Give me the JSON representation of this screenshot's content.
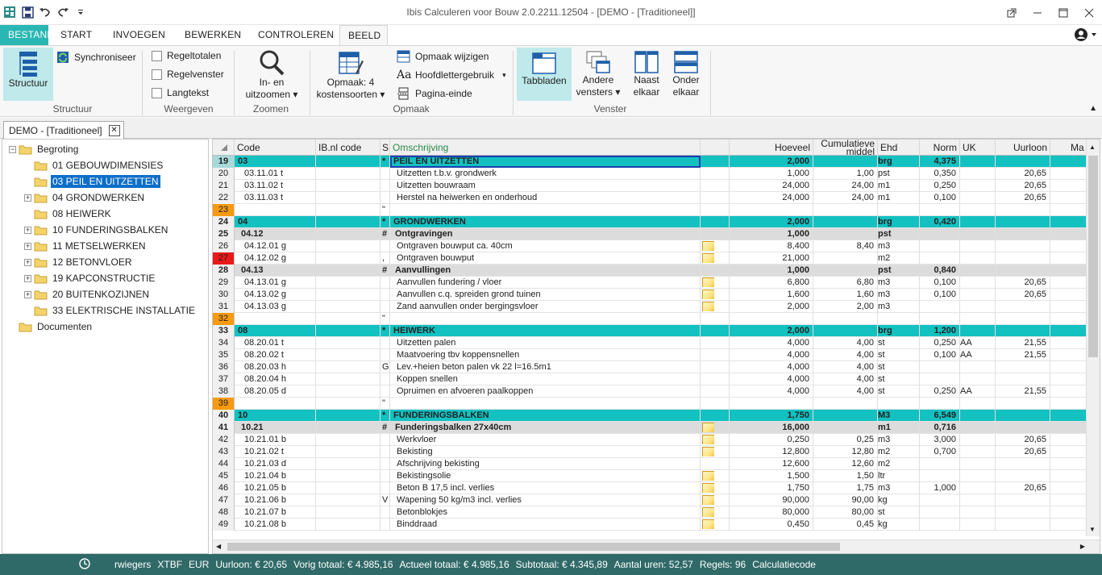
{
  "window": {
    "title": "Ibis Calculeren voor Bouw 2.0.2211.12504 - [DEMO - [Traditioneel]]"
  },
  "ribbon_tabs": [
    "BESTAND",
    "START",
    "INVOEGEN",
    "BEWERKEN",
    "CONTROLEREN",
    "BEELD"
  ],
  "ribbon": {
    "structuur": {
      "btn": "Structuur",
      "sync": "Synchroniseer",
      "group": "Structuur"
    },
    "weergeven": {
      "items": [
        "Regeltotalen",
        "Regelvenster",
        "Langtekst"
      ],
      "group": "Weergeven"
    },
    "zoomen": {
      "line1": "In- en",
      "line2": "uitzoomen",
      "group": "Zoomen"
    },
    "opmaak": {
      "btn_line1": "Opmaak: 4",
      "btn_line2": "kostensoorten",
      "wijzigen": "Opmaak wijzigen",
      "hoofdletter": "Hoofdlettergebruik",
      "pagina": "Pagina-einde",
      "group": "Opmaak"
    },
    "venster": {
      "tabbladen": "Tabbladen",
      "andere1": "Andere",
      "andere2": "vensters",
      "naast1": "Naast",
      "naast2": "elkaar",
      "onder1": "Onder",
      "onder2": "elkaar",
      "group": "Venster"
    }
  },
  "doc_tab": "DEMO - [Traditioneel]",
  "tree": {
    "root": "Begroting",
    "items": [
      {
        "label": "01 GEBOUWDIMENSIES",
        "expandable": false
      },
      {
        "label": "03 PEIL EN UITZETTEN",
        "expandable": false
      },
      {
        "label": "04 GRONDWERKEN",
        "expandable": true
      },
      {
        "label": "08 HEIWERK",
        "expandable": false
      },
      {
        "label": "10 FUNDERINGSBALKEN",
        "expandable": true
      },
      {
        "label": "11 METSELWERKEN",
        "expandable": true
      },
      {
        "label": "12 BETONVLOER",
        "expandable": true
      },
      {
        "label": "19 KAPCONSTRUCTIE",
        "expandable": true
      },
      {
        "label": "20 BUITENKOZIJNEN",
        "expandable": true
      },
      {
        "label": "33 ELEKTRISCHE INSTALLATIE",
        "expandable": false
      }
    ],
    "documents": "Documenten"
  },
  "grid": {
    "headers": {
      "code": "Code",
      "ibnl": "IB.nl code",
      "s": "S",
      "omschrijving": "Omschrijving",
      "hoeveel": "Hoeveel",
      "cum1": "Cumulatieve",
      "cum2": "middel",
      "ehd": "Ehd",
      "norm": "Norm",
      "uk": "UK",
      "uurloon": "Uurloon",
      "ma": "Ma"
    },
    "rows": [
      {
        "n": "19",
        "style": "teal",
        "rn": "active",
        "code": "03",
        "s": "*",
        "desc": "PEIL EN UITZETTEN",
        "qty": "2,000",
        "cum": "",
        "ehd": "brg",
        "norm": "4,375",
        "uk": "",
        "uur": "",
        "note": false
      },
      {
        "n": "20",
        "style": "",
        "rn": "",
        "code": "03.11.01  t",
        "s": "",
        "desc": "Uitzetten t.b.v. grondwerk",
        "qty": "1,000",
        "cum": "1,00",
        "ehd": "pst",
        "norm": "0,350",
        "uk": "",
        "uur": "20,65",
        "note": false
      },
      {
        "n": "21",
        "style": "",
        "rn": "",
        "code": "03.11.02  t",
        "s": "",
        "desc": "Uitzetten bouwraam",
        "qty": "24,000",
        "cum": "24,00",
        "ehd": "m1",
        "norm": "0,250",
        "uk": "",
        "uur": "20,65",
        "note": false
      },
      {
        "n": "22",
        "style": "",
        "rn": "",
        "code": "03.11.03  t",
        "s": "",
        "desc": "Herstel na heiwerken en onderhoud",
        "qty": "24,000",
        "cum": "24,00",
        "ehd": "m1",
        "norm": "0,100",
        "uk": "",
        "uur": "20,65",
        "note": false
      },
      {
        "n": "23",
        "style": "",
        "rn": "orange",
        "code": "",
        "s": "\"",
        "desc": "",
        "qty": "",
        "cum": "",
        "ehd": "",
        "norm": "",
        "uk": "",
        "uur": "",
        "note": false
      },
      {
        "n": "24",
        "style": "teal",
        "rn": "",
        "code": "04",
        "s": "*",
        "desc": "GRONDWERKEN",
        "qty": "2,000",
        "cum": "",
        "ehd": "brg",
        "norm": "0,420",
        "uk": "",
        "uur": "",
        "note": false
      },
      {
        "n": "25",
        "style": "grey",
        "rn": "",
        "code": "04.12",
        "s": "#",
        "desc": "Ontgravingen",
        "qty": "1,000",
        "cum": "",
        "ehd": "pst",
        "norm": "",
        "uk": "",
        "uur": "",
        "note": false
      },
      {
        "n": "26",
        "style": "",
        "rn": "",
        "code": "04.12.01  g",
        "s": "",
        "desc": "Ontgraven bouwput ca. 40cm",
        "qty": "8,400",
        "cum": "8,40",
        "ehd": "m3",
        "norm": "",
        "uk": "",
        "uur": "",
        "note": true
      },
      {
        "n": "27",
        "style": "",
        "rn": "red",
        "code": "04.12.02  g",
        "s": ",",
        "desc": "Ontgraven bouwput",
        "qty": "21,000",
        "cum": "",
        "ehd": "m2",
        "norm": "",
        "uk": "",
        "uur": "",
        "note": true
      },
      {
        "n": "28",
        "style": "grey",
        "rn": "",
        "code": "04.13",
        "s": "#",
        "desc": "Aanvullingen",
        "qty": "1,000",
        "cum": "",
        "ehd": "pst",
        "norm": "0,840",
        "uk": "",
        "uur": "",
        "note": false
      },
      {
        "n": "29",
        "style": "",
        "rn": "",
        "code": "04.13.01  g",
        "s": "",
        "desc": "Aanvullen fundering / vloer",
        "qty": "6,800",
        "cum": "6,80",
        "ehd": "m3",
        "norm": "0,100",
        "uk": "",
        "uur": "20,65",
        "note": true
      },
      {
        "n": "30",
        "style": "",
        "rn": "",
        "code": "04.13.02  g",
        "s": "",
        "desc": "Aanvullen c.q. spreiden grond tuinen",
        "qty": "1,600",
        "cum": "1,60",
        "ehd": "m3",
        "norm": "0,100",
        "uk": "",
        "uur": "20,65",
        "note": true
      },
      {
        "n": "31",
        "style": "",
        "rn": "",
        "code": "04.13.03  g",
        "s": "",
        "desc": "Zand aanvullen onder bergingsvloer",
        "qty": "2,000",
        "cum": "2,00",
        "ehd": "m3",
        "norm": "",
        "uk": "",
        "uur": "",
        "note": true
      },
      {
        "n": "32",
        "style": "",
        "rn": "orange",
        "code": "",
        "s": "\"",
        "desc": "",
        "qty": "",
        "cum": "",
        "ehd": "",
        "norm": "",
        "uk": "",
        "uur": "",
        "note": false
      },
      {
        "n": "33",
        "style": "teal",
        "rn": "",
        "code": "08",
        "s": "*",
        "desc": "HEIWERK",
        "qty": "2,000",
        "cum": "",
        "ehd": "brg",
        "norm": "1,200",
        "uk": "",
        "uur": "",
        "note": false
      },
      {
        "n": "34",
        "style": "",
        "rn": "",
        "code": "08.20.01  t",
        "s": "",
        "desc": "Uitzetten palen",
        "qty": "4,000",
        "cum": "4,00",
        "ehd": "st",
        "norm": "0,250",
        "uk": "AA",
        "uur": "21,55",
        "note": false
      },
      {
        "n": "35",
        "style": "",
        "rn": "",
        "code": "08.20.02  t",
        "s": "",
        "desc": "Maatvoering tbv koppensnellen",
        "qty": "4,000",
        "cum": "4,00",
        "ehd": "st",
        "norm": "0,100",
        "uk": "AA",
        "uur": "21,55",
        "note": false
      },
      {
        "n": "36",
        "style": "",
        "rn": "",
        "code": "08.20.03  h",
        "s": "G",
        "desc": "Lev.+heien beton palen vk 22 l=16.5m1",
        "qty": "4,000",
        "cum": "4,00",
        "ehd": "st",
        "norm": "",
        "uk": "",
        "uur": "",
        "note": false
      },
      {
        "n": "37",
        "style": "",
        "rn": "",
        "code": "08.20.04  h",
        "s": "",
        "desc": "Koppen snellen",
        "qty": "4,000",
        "cum": "4,00",
        "ehd": "st",
        "norm": "",
        "uk": "",
        "uur": "",
        "note": false
      },
      {
        "n": "38",
        "style": "",
        "rn": "",
        "code": "08.20.05  d",
        "s": "",
        "desc": "Opruimen en afvoeren paalkoppen",
        "qty": "4,000",
        "cum": "4,00",
        "ehd": "st",
        "norm": "0,250",
        "uk": "AA",
        "uur": "21,55",
        "note": false
      },
      {
        "n": "39",
        "style": "",
        "rn": "orange",
        "code": "",
        "s": "\"",
        "desc": "",
        "qty": "",
        "cum": "",
        "ehd": "",
        "norm": "",
        "uk": "",
        "uur": "",
        "note": false
      },
      {
        "n": "40",
        "style": "teal",
        "rn": "",
        "code": "10",
        "s": "*",
        "desc": "FUNDERINGSBALKEN",
        "qty": "1,750",
        "cum": "",
        "ehd": "M3",
        "norm": "6,549",
        "uk": "",
        "uur": "",
        "note": false
      },
      {
        "n": "41",
        "style": "grey",
        "rn": "",
        "code": "10.21",
        "s": "#",
        "desc": "Funderingsbalken 27x40cm",
        "qty": "16,000",
        "cum": "",
        "ehd": "m1",
        "norm": "0,716",
        "uk": "",
        "uur": "",
        "note": true
      },
      {
        "n": "42",
        "style": "",
        "rn": "",
        "code": "10.21.01  b",
        "s": "",
        "desc": "Werkvloer",
        "qty": "0,250",
        "cum": "0,25",
        "ehd": "m3",
        "norm": "3,000",
        "uk": "",
        "uur": "20,65",
        "note": true
      },
      {
        "n": "43",
        "style": "",
        "rn": "",
        "code": "10.21.02  t",
        "s": "",
        "desc": "Bekisting",
        "qty": "12,800",
        "cum": "12,80",
        "ehd": "m2",
        "norm": "0,700",
        "uk": "",
        "uur": "20,65",
        "note": true
      },
      {
        "n": "44",
        "style": "",
        "rn": "",
        "code": "10.21.03  d",
        "s": "",
        "desc": "Afschrijving bekisting",
        "qty": "12,600",
        "cum": "12,60",
        "ehd": "m2",
        "norm": "",
        "uk": "",
        "uur": "",
        "note": false
      },
      {
        "n": "45",
        "style": "",
        "rn": "",
        "code": "10.21.04  b",
        "s": "",
        "desc": "Bekistingsolie",
        "qty": "1,500",
        "cum": "1,50",
        "ehd": "ltr",
        "norm": "",
        "uk": "",
        "uur": "",
        "note": true
      },
      {
        "n": "46",
        "style": "",
        "rn": "",
        "code": "10.21.05  b",
        "s": "",
        "desc": "Beton B 17,5       incl. verlies",
        "qty": "1,750",
        "cum": "1,75",
        "ehd": "m3",
        "norm": "1,000",
        "uk": "",
        "uur": "20,65",
        "note": true
      },
      {
        "n": "47",
        "style": "",
        "rn": "",
        "code": "10.21.06  b",
        "s": "V",
        "desc": "Wapening 50 kg/m3 incl. verlies",
        "qty": "90,000",
        "cum": "90,00",
        "ehd": "kg",
        "norm": "",
        "uk": "",
        "uur": "",
        "note": true
      },
      {
        "n": "48",
        "style": "",
        "rn": "",
        "code": "10.21.07  b",
        "s": "",
        "desc": "Betonblokjes",
        "qty": "80,000",
        "cum": "80,00",
        "ehd": "st",
        "norm": "",
        "uk": "",
        "uur": "",
        "note": true
      },
      {
        "n": "49",
        "style": "",
        "rn": "",
        "code": "10.21.08  b",
        "s": "",
        "desc": "Binddraad",
        "qty": "0,450",
        "cum": "0,45",
        "ehd": "kg",
        "norm": "",
        "uk": "",
        "uur": "",
        "note": true
      }
    ]
  },
  "status": {
    "user": "rwiegers",
    "format": "XTBF",
    "currency": "EUR",
    "uurloon": "Uurloon: € 20,65",
    "vorig": "Vorig totaal: € 4.985,16",
    "actueel": "Actueel totaal: € 4.985,16",
    "subtotaal": "Subtotaal: € 4.345,89",
    "uren": "Aantal uren: 52,57",
    "regels": "Regels: 96",
    "calc": "Calculatiecode"
  },
  "colors": {
    "teal": "#13c1c1",
    "ribbon_file": "#2ab7b3",
    "status_bar": "#306a68",
    "tree_selection": "#0b6fc9",
    "orange_marker": "#f79a0f",
    "red_marker": "#e8191a"
  }
}
